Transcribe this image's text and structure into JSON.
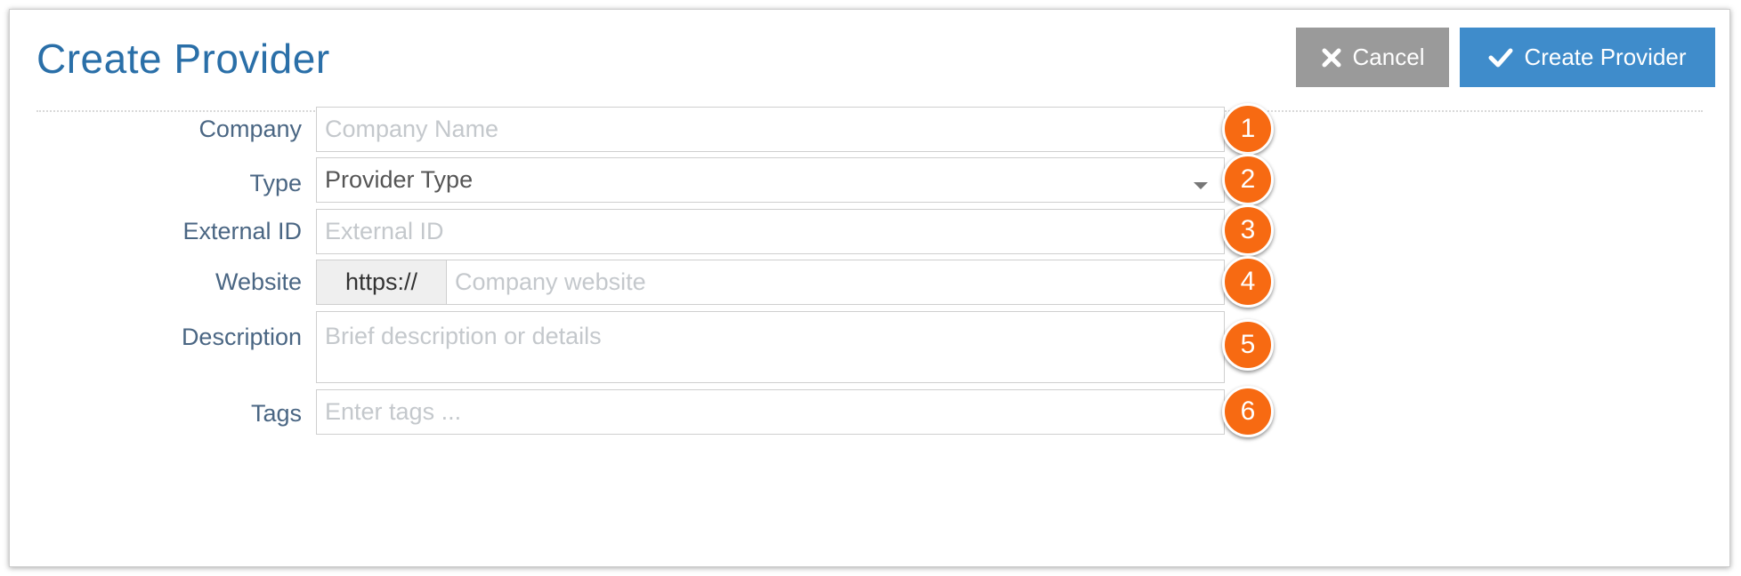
{
  "page": {
    "title": "Create Provider"
  },
  "actions": {
    "cancel_label": "Cancel",
    "create_label": "Create Provider"
  },
  "form": {
    "company": {
      "label": "Company",
      "placeholder": "Company Name",
      "badge": "1"
    },
    "type": {
      "label": "Type",
      "value": "Provider Type",
      "badge": "2"
    },
    "external_id": {
      "label": "External ID",
      "placeholder": "External ID",
      "badge": "3"
    },
    "website": {
      "label": "Website",
      "prefix": "https://",
      "placeholder": "Company website",
      "badge": "4"
    },
    "description": {
      "label": "Description",
      "placeholder": "Brief description or details",
      "badge": "5"
    },
    "tags": {
      "label": "Tags",
      "placeholder": "Enter tags ...",
      "badge": "6"
    }
  },
  "colors": {
    "title": "#2a6fa8",
    "create_button": "#3f8ccb",
    "cancel_button": "#9a9a9a",
    "badge": "#f76a12",
    "label": "#4a6683"
  },
  "icons": {
    "cancel": "close-icon",
    "create": "checkmark-icon",
    "type_dropdown": "caret-down-icon"
  }
}
